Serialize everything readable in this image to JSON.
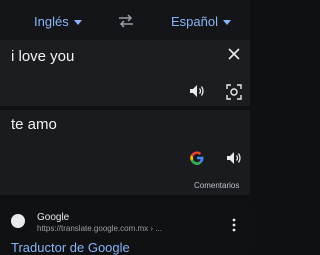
{
  "languages": {
    "source": "Inglés",
    "target": "Español"
  },
  "input": {
    "text": "i love you"
  },
  "output": {
    "text": "te amo",
    "feedback_label": "Comentarios"
  },
  "search_result": {
    "site_name": "Google",
    "url": "https://translate.google.com.mx › ...",
    "title": "Traductor de Google"
  },
  "icons": {
    "swap": "swap-arrows-icon",
    "clear": "close-icon",
    "speaker": "speaker-icon",
    "camera": "lens-camera-icon",
    "google": "google-g-icon",
    "more": "more-vert-icon"
  },
  "colors": {
    "accent": "#8ab4f8",
    "background": "#0f1012",
    "card": "#1c1d20",
    "text": "#e8eaed",
    "muted": "#9aa0a6"
  }
}
